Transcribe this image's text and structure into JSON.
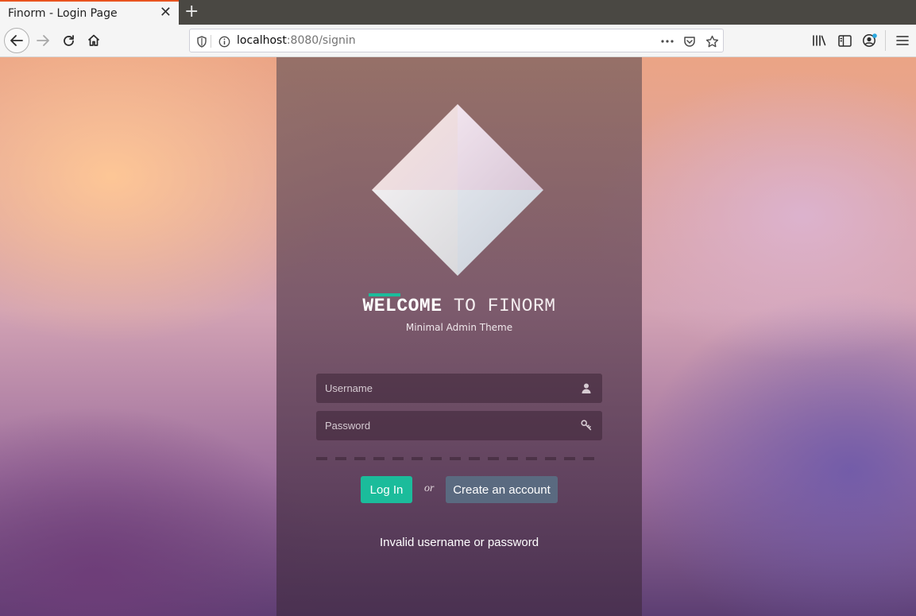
{
  "browser": {
    "tab_title": "Finorm - Login Page",
    "url_host": "localhost",
    "url_rest": ":8080/signin"
  },
  "page": {
    "welcome_bold": "WELCOME",
    "welcome_rest": " TO FINORM",
    "subtitle": "Minimal Admin Theme",
    "username_placeholder": "Username",
    "password_placeholder": "Password",
    "login_label": "Log In",
    "or_label": "or",
    "create_label": "Create an account",
    "error_message": "Invalid username or password"
  },
  "colors": {
    "accent": "#1bbc9b",
    "secondary_button": "#5a6a80"
  },
  "icons": [
    "back-icon",
    "forward-icon",
    "reload-icon",
    "home-icon",
    "shield-icon",
    "info-icon",
    "more-icon",
    "pocket-icon",
    "star-icon",
    "library-icon",
    "sidebar-icon",
    "account-icon",
    "menu-icon",
    "user-icon",
    "key-icon",
    "diamond-logo"
  ]
}
